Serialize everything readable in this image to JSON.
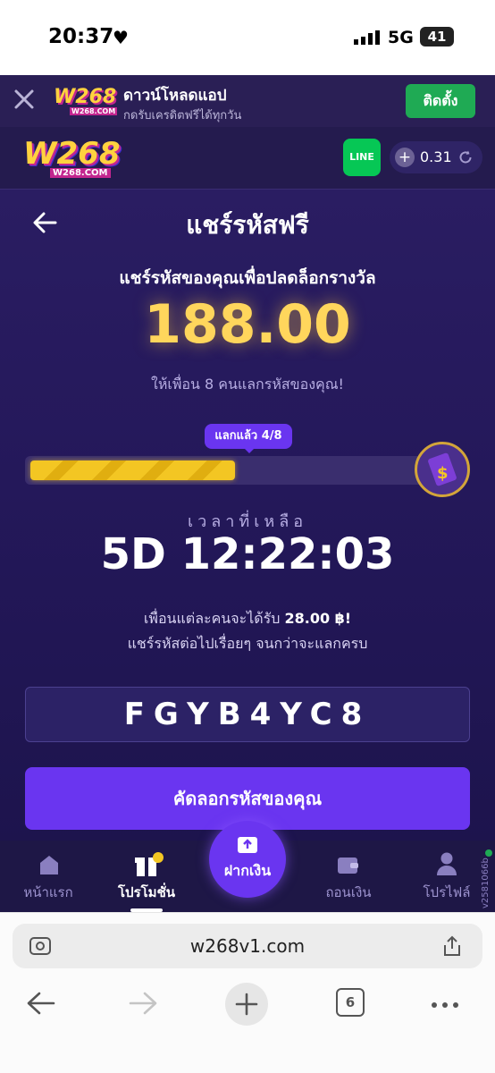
{
  "status_bar": {
    "time": "20:37",
    "network": "5G",
    "battery": "41"
  },
  "banner": {
    "logo_text": "W268",
    "logo_sub": "W268.COM",
    "title": "ดาวน์โหลดแอป",
    "subtitle": "กดรับเครดิตฟรีได้ทุกวัน",
    "install_label": "ติดตั้ง"
  },
  "header": {
    "logo_text": "W268",
    "logo_sub": "W268.COM",
    "line_label": "LINE",
    "balance": "0.31"
  },
  "page": {
    "title": "แชร์รหัสฟรี",
    "subtitle": "แชร์รหัสของคุณเพื่อปลดล็อกรางวัล",
    "reward_amount": "188.00",
    "invite_note": "ให้เพื่อน 8 คนแลกรหัสของคุณ!",
    "progress_badge": "แลกแล้ว 4/8",
    "progress_fraction": 0.5,
    "time_left_label": "เวลาที่เหลือ",
    "countdown": "5D 12:22:03",
    "friend_reward_prefix": "เพื่อนแต่ละคนจะได้รับ ",
    "friend_reward_amount": "28.00 ฿!",
    "share_note": "แชร์รหัสต่อไปเรื่อยๆ จนกว่าจะแลกครบ",
    "code": "FGYB4YC8",
    "copy_label": "คัดลอกรหัสของคุณ"
  },
  "nav": {
    "home": "หน้าแรก",
    "promotions": "โปรโมชั่น",
    "deposit": "ฝากเงิน",
    "withdraw": "ถอนเงิน",
    "profile": "โปรไฟล์",
    "version": "v2581066b"
  },
  "browser": {
    "url": "w268v1.com",
    "tab_count": "6"
  },
  "colors": {
    "accent_purple": "#6a35f0",
    "gold": "#f2c94c",
    "install_green": "#1faa54"
  }
}
